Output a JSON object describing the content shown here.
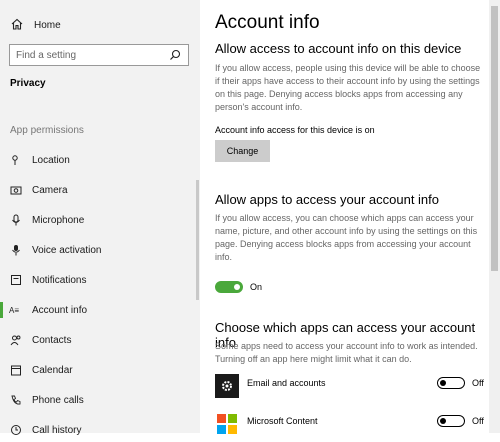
{
  "sidebar": {
    "home_label": "Home",
    "search_placeholder": "Find a setting",
    "section_title": "Privacy",
    "group_title": "App permissions",
    "items": [
      {
        "label": "Location",
        "icon": "location-icon"
      },
      {
        "label": "Camera",
        "icon": "camera-icon"
      },
      {
        "label": "Microphone",
        "icon": "microphone-icon"
      },
      {
        "label": "Voice activation",
        "icon": "voice-activation-icon"
      },
      {
        "label": "Notifications",
        "icon": "notifications-icon"
      },
      {
        "label": "Account info",
        "icon": "account-info-icon",
        "active": true
      },
      {
        "label": "Contacts",
        "icon": "contacts-icon"
      },
      {
        "label": "Calendar",
        "icon": "calendar-icon"
      },
      {
        "label": "Phone calls",
        "icon": "phone-calls-icon"
      },
      {
        "label": "Call history",
        "icon": "call-history-icon"
      }
    ]
  },
  "main": {
    "title": "Account info",
    "device_section": {
      "heading": "Allow access to account info on this device",
      "description": "If you allow access, people using this device will be able to choose if their apps have access to their account info by using the settings on this page. Denying access blocks apps from accessing any person's account info.",
      "status": "Account info access for this device is on",
      "button_label": "Change"
    },
    "apps_section": {
      "heading": "Allow apps to access your account info",
      "description": "If you allow access, you can choose which apps can access your name, picture, and other account info by using the settings on this page. Denying access blocks apps from accessing your account info.",
      "toggle_label": "On"
    },
    "choose_section": {
      "heading": "Choose which apps can access your account info",
      "description": "Some apps need to access your account info to work as intended. Turning off an app here might limit what it can do.",
      "apps": [
        {
          "name": "Email and accounts",
          "toggle_label": "Off",
          "icon": "gear-icon"
        },
        {
          "name": "Microsoft Content",
          "toggle_label": "Off",
          "icon": "microsoft-logo-icon"
        }
      ]
    }
  },
  "colors": {
    "accent": "#4aa83b",
    "sidebar_bg": "#f2f2f2",
    "button_bg": "#cccccc"
  }
}
